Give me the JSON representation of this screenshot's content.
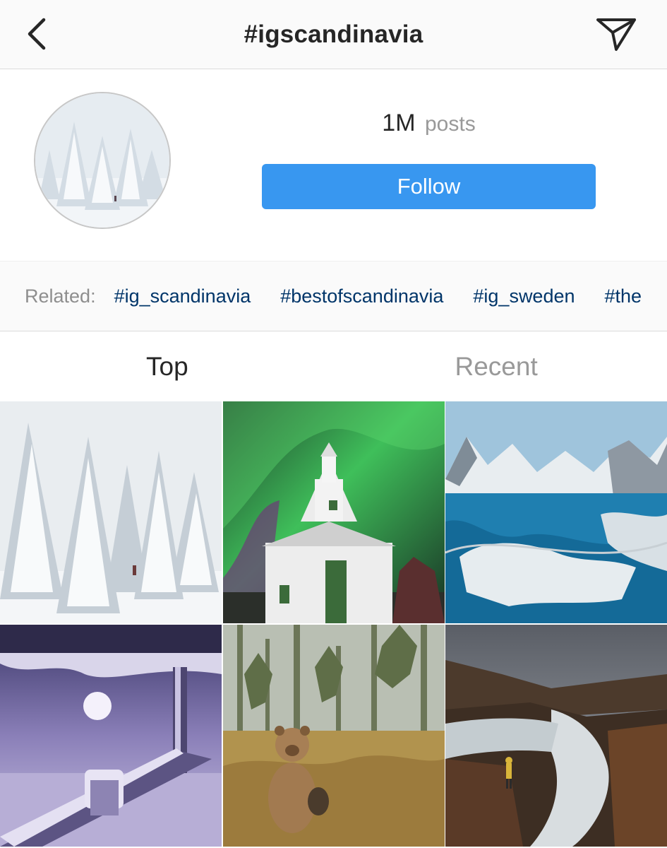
{
  "header": {
    "title": "#igscandinavia",
    "back_icon": "chevron-left-icon",
    "direct_icon": "paper-plane-icon"
  },
  "profile": {
    "posts_count": "1M",
    "posts_label": "posts",
    "follow_label": "Follow",
    "accent_color": "#3897f0"
  },
  "related": {
    "label": "Related:",
    "tags": [
      "#ig_scandinavia",
      "#bestofscandinavia",
      "#ig_sweden",
      "#the"
    ]
  },
  "tabs": {
    "top": "Top",
    "recent": "Recent",
    "active": "Top"
  },
  "grid": {
    "tiles": [
      {
        "subject": "snowy forest"
      },
      {
        "subject": "church with northern lights"
      },
      {
        "subject": "snowy mountains and fjord"
      },
      {
        "subject": "frozen porch with full moon"
      },
      {
        "subject": "bear in forest"
      },
      {
        "subject": "waterfall canyon"
      }
    ]
  }
}
